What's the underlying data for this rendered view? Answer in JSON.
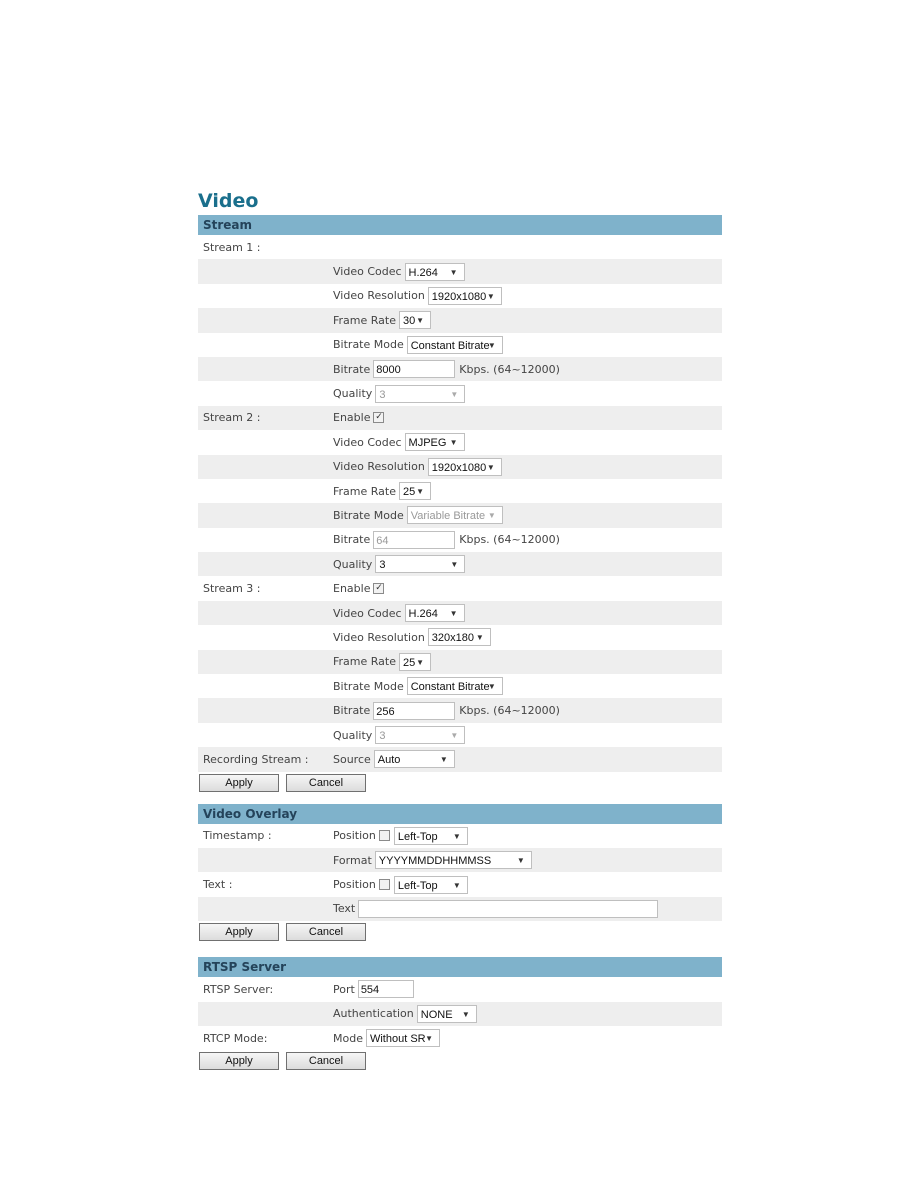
{
  "title": "Video",
  "stream_section": {
    "header": "Stream",
    "stream1": {
      "label": "Stream 1 :",
      "video_codec_label": "Video Codec",
      "video_codec": "H.264",
      "resolution_label": "Video Resolution",
      "resolution": "1920x1080",
      "frame_rate_label": "Frame Rate",
      "frame_rate": "30",
      "bitrate_mode_label": "Bitrate Mode",
      "bitrate_mode": "Constant Bitrate",
      "bitrate_label": "Bitrate",
      "bitrate": "8000",
      "bitrate_unit": "Kbps. (64~12000)",
      "quality_label": "Quality",
      "quality": "3"
    },
    "stream2": {
      "label": "Stream 2 :",
      "enable_label": "Enable",
      "enable_checked": "✓",
      "video_codec_label": "Video Codec",
      "video_codec": "MJPEG",
      "resolution_label": "Video Resolution",
      "resolution": "1920x1080",
      "frame_rate_label": "Frame Rate",
      "frame_rate": "25",
      "bitrate_mode_label": "Bitrate Mode",
      "bitrate_mode": "Variable Bitrate",
      "bitrate_label": "Bitrate",
      "bitrate": "64",
      "bitrate_unit": "Kbps. (64~12000)",
      "quality_label": "Quality",
      "quality": "3"
    },
    "stream3": {
      "label": "Stream 3 :",
      "enable_label": "Enable",
      "enable_checked": "✓",
      "video_codec_label": "Video Codec",
      "video_codec": "H.264",
      "resolution_label": "Video Resolution",
      "resolution": "320x180",
      "frame_rate_label": "Frame Rate",
      "frame_rate": "25",
      "bitrate_mode_label": "Bitrate Mode",
      "bitrate_mode": "Constant Bitrate",
      "bitrate_label": "Bitrate",
      "bitrate": "256",
      "bitrate_unit": "Kbps. (64~12000)",
      "quality_label": "Quality",
      "quality": "3"
    },
    "recording": {
      "label": "Recording Stream :",
      "source_label": "Source",
      "source": "Auto"
    },
    "apply": "Apply",
    "cancel": "Cancel"
  },
  "overlay_section": {
    "header": "Video Overlay",
    "timestamp": {
      "label": "Timestamp :",
      "position_label": "Position",
      "position": "Left-Top",
      "format_label": "Format",
      "format": "YYYYMMDDHHMMSS"
    },
    "text": {
      "label": "Text :",
      "position_label": "Position",
      "position": "Left-Top",
      "text_label": "Text",
      "text_value": ""
    },
    "apply": "Apply",
    "cancel": "Cancel"
  },
  "rtsp_section": {
    "header": "RTSP Server",
    "server": {
      "label": "RTSP Server:",
      "port_label": "Port",
      "port": "554",
      "auth_label": "Authentication",
      "auth": "NONE"
    },
    "rtcp": {
      "label": "RTCP Mode:",
      "mode_label": "Mode",
      "mode": "Without SR"
    },
    "apply": "Apply",
    "cancel": "Cancel"
  },
  "icons": {
    "dropdown": "▼"
  }
}
